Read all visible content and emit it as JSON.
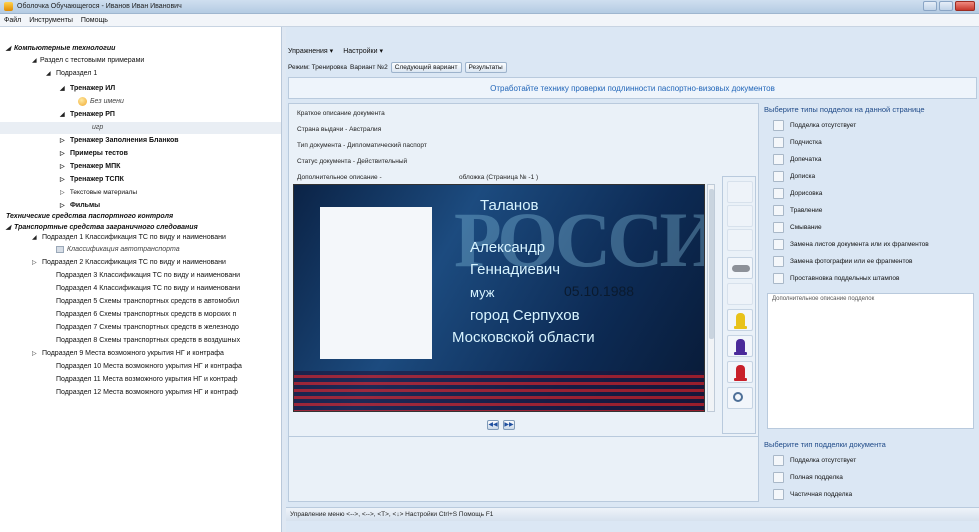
{
  "window": {
    "title": "Оболочка Обучающегося - Иванов Иван Иванович"
  },
  "menu": [
    "Файл",
    "Инструменты",
    "Помощь"
  ],
  "tree": [
    {
      "label": "Компьютерные технологии"
    },
    {
      "label": "Раздел с тестовыми примерами"
    },
    {
      "label": "Подраздел 1"
    },
    {
      "label": "Тренажер ИЛ"
    },
    {
      "label": "Без имени"
    },
    {
      "label": "Тренажер РП"
    },
    {
      "label": "игр"
    },
    {
      "label": "Тренажер Заполнения Бланков"
    },
    {
      "label": "Примеры тестов"
    },
    {
      "label": "Тренажер МПК"
    },
    {
      "label": "Тренажер ТСПК"
    },
    {
      "label": "Текстовые материалы"
    },
    {
      "label": "Фильмы"
    },
    {
      "label": "Технические средства паспортного контроля"
    },
    {
      "label": "Транспортные средства заграничного следования"
    },
    {
      "label": "Подраздел 1 Классификация ТС по виду и наименовани"
    },
    {
      "label": "Классификация автотранспорта"
    },
    {
      "label": "Подраздел 2 Классификация ТС по виду и наименовани"
    },
    {
      "label": "Подраздел 3 Классификация ТС по виду и наименовани"
    },
    {
      "label": "Подраздел 4 Классификация ТС по виду и наименовани"
    },
    {
      "label": "Подраздел 5 Схемы транспортных средств в автомобил"
    },
    {
      "label": "Подраздел 6 Схемы транспортных средств в морских п"
    },
    {
      "label": "Подраздел 7 Схемы транспортных средств в железнодо"
    },
    {
      "label": "Подраздел 8 Схемы транспортных средств в воздушных"
    },
    {
      "label": "Подраздел 9 Места возможного укрытия НГ и контрафа"
    },
    {
      "label": "Подраздел 10 Места возможного укрытия НГ и контрафа"
    },
    {
      "label": "Подраздел 11 Места возможного укрытия НГ и контраф"
    },
    {
      "label": "Подраздел 12 Места возможного укрытия НГ и контраф"
    }
  ],
  "toolbar": {
    "exercises": "Упражнения ▾",
    "settings": "Настройки ▾"
  },
  "mode": {
    "label": "Режим: Тренировка",
    "variant": "Вариант №2",
    "next": "Следующий вариант",
    "results": "Результаты"
  },
  "banner": "Отработайте технику проверки подлинности паспортно-визовых документов",
  "doc": {
    "short": "Краткое описание документа",
    "country": "Страна выдачи - Австралия",
    "type": "Тип документа - Дипломатический паспорт",
    "status": "Статус документа - Действительный",
    "extra": "Дополнительное описание -",
    "page": "обложка   (Страница № -1 )"
  },
  "passport": {
    "ghost": "РОССИЯ",
    "surname": "Таланов",
    "name": "Александр",
    "patronymic": "Геннадиевич",
    "sex": "муж",
    "date": "05.10.1988",
    "city": "город Серпухов",
    "region": "Московской области"
  },
  "forgery_types": {
    "heading": "Выберите типы подделок на данной странице",
    "items": [
      "Подделка отсутствует",
      "Подчистка",
      "Допечатка",
      "Дописка",
      "Дорисовка",
      "Травление",
      "Смывание",
      "Замена листов документа или их фрагментов",
      "Замена фотографии или ее фрагментов",
      "Проставновка поддельных штампов"
    ]
  },
  "forgery_desc_label": "Дополнительное описание подделок",
  "doc_forgery": {
    "heading": "Выберите тип подделки документа",
    "items": [
      "Подделка отсутствует",
      "Полная подделка",
      "Частичная подделка"
    ]
  },
  "statusbar": "Управление меню <-->, <-->, <T>, <↓>  Настройки Ctrl+S  Помощь F1",
  "colors": {
    "accent": "#1f64b8",
    "stripe": "#c81e28"
  }
}
